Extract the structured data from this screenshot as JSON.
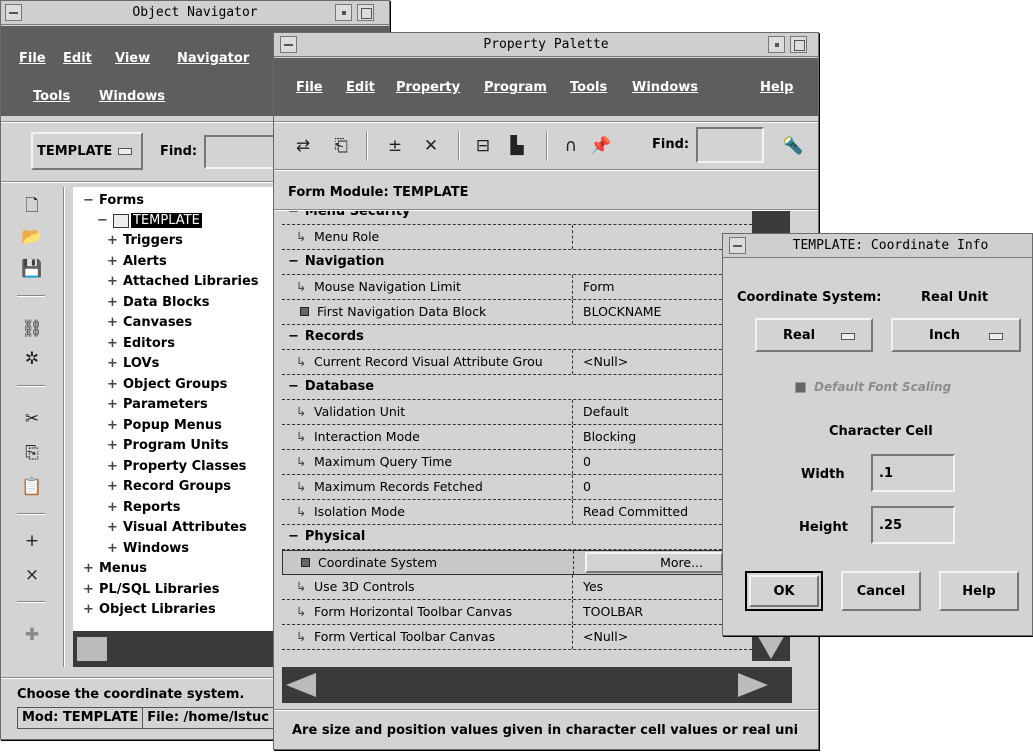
{
  "object_navigator": {
    "title": "Object Navigator",
    "menu": [
      "File",
      "Edit",
      "View",
      "Navigator",
      "Tools",
      "Windows"
    ],
    "context_value": "TEMPLATE",
    "find_label": "Find:",
    "tree": {
      "root": "Forms",
      "module": "TEMPLATE",
      "children": [
        "Triggers",
        "Alerts",
        "Attached Libraries",
        "Data Blocks",
        "Canvases",
        "Editors",
        "LOVs",
        "Object Groups",
        "Parameters",
        "Popup Menus",
        "Program Units",
        "Property Classes",
        "Record Groups",
        "Reports",
        "Visual Attributes",
        "Windows"
      ],
      "siblings": [
        "Menus",
        "PL/SQL Libraries",
        "Object Libraries"
      ]
    },
    "hint": "Choose the coordinate system.",
    "status_module": "Mod: TEMPLATE",
    "status_file": "File: /home/lstuc"
  },
  "property_palette": {
    "title": "Property Palette",
    "menu": [
      "File",
      "Edit",
      "Property",
      "Program",
      "Tools",
      "Windows",
      "Help"
    ],
    "find_label": "Find:",
    "context": "Form Module: TEMPLATE",
    "rows": [
      {
        "kind": "cat",
        "name": "Menu Security",
        "value": ""
      },
      {
        "kind": "prop",
        "name": "Menu Role",
        "value": ""
      },
      {
        "kind": "cat",
        "name": "Navigation",
        "value": ""
      },
      {
        "kind": "prop",
        "name": "Mouse Navigation Limit",
        "value": "Form"
      },
      {
        "kind": "changed",
        "name": "First Navigation Data Block",
        "value": "BLOCKNAME"
      },
      {
        "kind": "cat",
        "name": "Records",
        "value": ""
      },
      {
        "kind": "prop",
        "name": "Current Record Visual Attribute Grou",
        "value": "<Null>"
      },
      {
        "kind": "cat",
        "name": "Database",
        "value": ""
      },
      {
        "kind": "prop",
        "name": "Validation Unit",
        "value": "Default"
      },
      {
        "kind": "prop",
        "name": "Interaction Mode",
        "value": "Blocking"
      },
      {
        "kind": "prop",
        "name": "Maximum Query Time",
        "value": "0"
      },
      {
        "kind": "prop",
        "name": "Maximum Records Fetched",
        "value": "0"
      },
      {
        "kind": "prop",
        "name": "Isolation Mode",
        "value": "Read Committed"
      },
      {
        "kind": "cat",
        "name": "Physical",
        "value": ""
      },
      {
        "kind": "selected",
        "name": "Coordinate System",
        "value": "More..."
      },
      {
        "kind": "prop",
        "name": "Use 3D Controls",
        "value": "Yes"
      },
      {
        "kind": "prop",
        "name": "Form Horizontal Toolbar Canvas",
        "value": "TOOLBAR"
      },
      {
        "kind": "prop",
        "name": "Form Vertical Toolbar Canvas",
        "value": "<Null>"
      }
    ],
    "hint": "Are size and position values given in character cell values or real uni"
  },
  "coord_dialog": {
    "title": "TEMPLATE: Coordinate Info",
    "coord_system_label": "Coordinate System:",
    "real_unit_label": "Real Unit",
    "coord_system_value": "Real",
    "real_unit_value": "Inch",
    "default_font_scaling": "Default Font Scaling",
    "char_cell_label": "Character Cell",
    "width_label": "Width",
    "width_value": ".1",
    "height_label": "Height",
    "height_value": ".25",
    "ok": "OK",
    "cancel": "Cancel",
    "help": "Help"
  }
}
